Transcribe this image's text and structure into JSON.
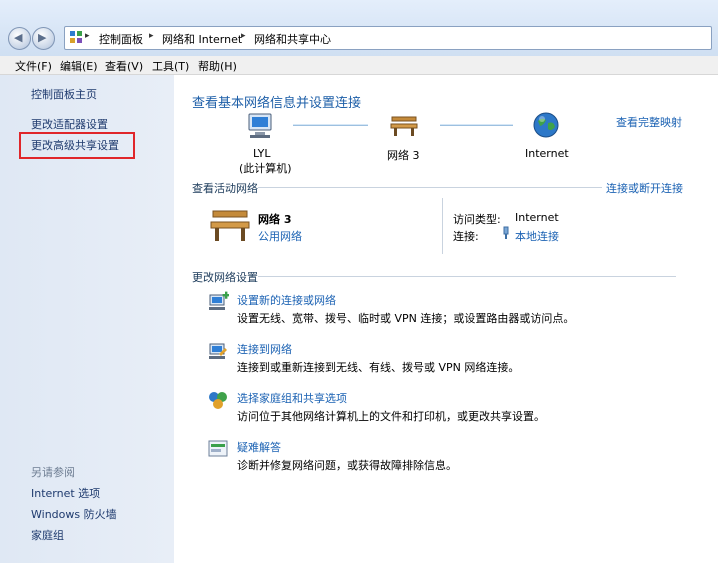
{
  "breadcrumb": [
    "控制面板",
    "网络和 Internet",
    "网络和共享中心"
  ],
  "menu": [
    "文件(F)",
    "编辑(E)",
    "查看(V)",
    "工具(T)",
    "帮助(H)"
  ],
  "sidebar": {
    "items": [
      "控制面板主页",
      "更改适配器设置",
      "更改高级共享设置"
    ],
    "see_also_title": "另请参阅",
    "see_also": [
      "Internet 选项",
      "Windows 防火墙",
      "家庭组"
    ]
  },
  "main": {
    "title": "查看基本网络信息并设置连接",
    "view_full_map": "查看完整映射",
    "map": {
      "computer_name": "LYL",
      "computer_sub": "(此计算机)",
      "network_name": "网络  3",
      "internet": "Internet"
    },
    "active": {
      "header": "查看活动网络",
      "connect_link": "连接或断开连接",
      "network_name": "网络  3",
      "network_type": "公用网络",
      "access_label": "访问类型:",
      "access_value": "Internet",
      "conn_label": "连接:",
      "conn_value": "本地连接"
    },
    "change": {
      "header": "更改网络设置",
      "tasks": [
        {
          "title": "设置新的连接或网络",
          "desc": "设置无线、宽带、拨号、临时或 VPN 连接；或设置路由器或访问点。",
          "icon": "new-connection-icon"
        },
        {
          "title": "连接到网络",
          "desc": "连接到或重新连接到无线、有线、拨号或 VPN 网络连接。",
          "icon": "connect-network-icon"
        },
        {
          "title": "选择家庭组和共享选项",
          "desc": "访问位于其他网络计算机上的文件和打印机，或更改共享设置。",
          "icon": "homegroup-icon"
        },
        {
          "title": "疑难解答",
          "desc": "诊断并修复网络问题，或获得故障排除信息。",
          "icon": "troubleshoot-icon"
        }
      ]
    }
  },
  "colors": {
    "link": "#1b62b3",
    "title": "#1e5fa8",
    "highlight": "#e0262a"
  }
}
